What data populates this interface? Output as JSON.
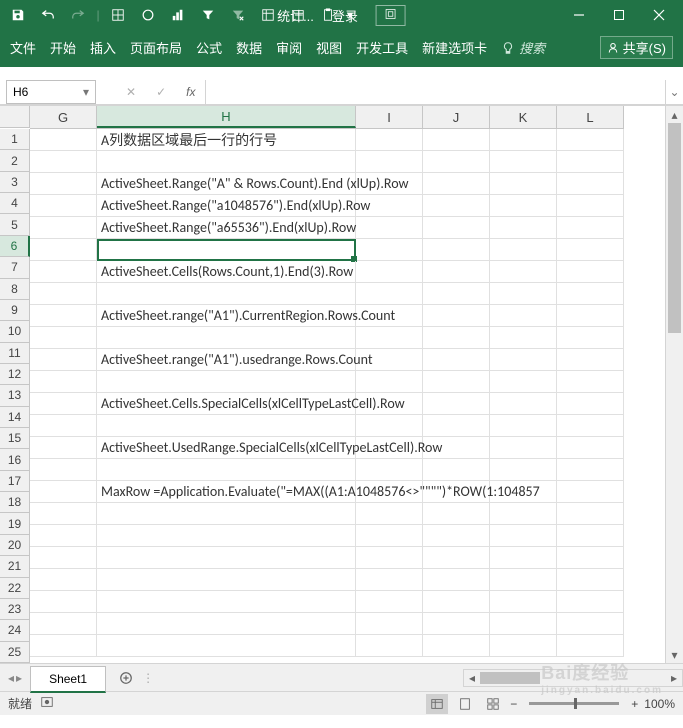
{
  "title_bar": {
    "title_abbr": "统计...",
    "login": "登录",
    "window_box_label": "团"
  },
  "ribbon": {
    "file": "文件",
    "home": "开始",
    "insert": "插入",
    "layout": "页面布局",
    "formulas": "公式",
    "data": "数据",
    "review": "审阅",
    "view": "视图",
    "dev": "开发工具",
    "newtab": "新建选项卡",
    "tell": "搜索",
    "share": "共享(S)"
  },
  "name_box": "H6",
  "columns": {
    "g": "G",
    "h": "H",
    "i": "I",
    "j": "J",
    "k": "K",
    "l": "L"
  },
  "rows": {
    "r1": "1",
    "r2": "2",
    "r3": "3",
    "r4": "4",
    "r5": "5",
    "r6": "6",
    "r7": "7",
    "r8": "8",
    "r9": "9",
    "r10": "10",
    "r11": "11",
    "r12": "12",
    "r13": "13",
    "r14": "14",
    "r15": "15",
    "r16": "16",
    "r17": "17",
    "r18": "18",
    "r19": "19",
    "r20": "20",
    "r21": "21",
    "r22": "22",
    "r23": "23",
    "r24": "24",
    "r25": "25"
  },
  "cells": {
    "H1": "A列数据区域最后一行的行号",
    "H3": "ActiveSheet.Range(\"A\" & Rows.Count).End (xlUp).Row",
    "H4": "ActiveSheet.Range(\"a1048576\").End(xlUp).Row",
    "H5": "ActiveSheet.Range(\"a65536\").End(xlUp).Row",
    "H7": "ActiveSheet.Cells(Rows.Count,1).End(3).Row",
    "H9": "ActiveSheet.range(\"A1\").CurrentRegion.Rows.Count",
    "H11": "ActiveSheet.range(\"A1\").usedrange.Rows.Count",
    "H13": "ActiveSheet.Cells.SpecialCells(xlCellTypeLastCell).Row",
    "H15": "ActiveSheet.UsedRange.SpecialCells(xlCellTypeLastCell).Row",
    "H17": "MaxRow =Application.Evaluate(\"=MAX((A1:A1048576<>\"\"\"\")*ROW(1:104857"
  },
  "sheet_tab": "Sheet1",
  "status": {
    "ready": "就绪",
    "zoom": "100%"
  },
  "watermark": {
    "main": "Bai度经验",
    "sub": "jingyan.baidu.com"
  }
}
